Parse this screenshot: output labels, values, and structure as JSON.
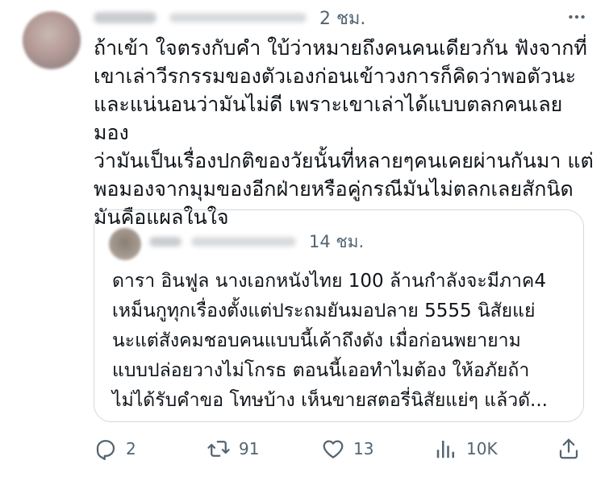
{
  "tweet": {
    "time": "2 ชม.",
    "text": "ถ้าเข้า ใจตรงกับคำ ใบ้ว่าหมายถึงคนคนเดียวกัน ฟังจากที่\nเขาเล่าวีรกรรมของตัวเองก่อนเข้าวงการก็คิดว่าพอตัวนะ\nและแน่นอนว่ามันไม่ดี เพราะเขาเล่าได้แบบตลกคนเลยมอง\nว่ามันเป็นเรื่องปกติของวัยนั้นที่หลายๆคนเคยผ่านกันมา แต่\nพอมองจากมุมของอีกฝ่ายหรือคู่กรณีมันไม่ตลกเลยสักนิด\nมันคือแผลในใจ"
  },
  "quote": {
    "time": "14 ชม.",
    "text": "ดารา อินฟูล นางเอกหนังไทย 100 ล้านกำลังจะมีภาค4\nเหม็นกูทุกเรื่องตั้งแต่ประถมยันมอปลาย 5555 นิสัยแย่\nนะแต่สังคมชอบคนแบบนี้เค้าถึงดัง  เมื่อก่อนพยายาม\nแบบปล่อยวางไม่โกรธ ตอนนี้เออทำไมต้อง ให้อภัยถ้า\nไม่ได้รับคำขอ โทษบ้าง เห็นขายสตอรี่นิสัยแย่ๆ แล้วดั..."
  },
  "actions": {
    "replies": "2",
    "retweets": "91",
    "likes": "13",
    "views": "10K"
  },
  "icons": {
    "more": "more-icon",
    "reply": "reply-icon",
    "retweet": "retweet-icon",
    "like": "heart-icon",
    "views": "views-icon",
    "share": "share-icon"
  },
  "colors": {
    "text": "#0f1419",
    "secondary": "#536471",
    "border": "#cfd9de"
  }
}
